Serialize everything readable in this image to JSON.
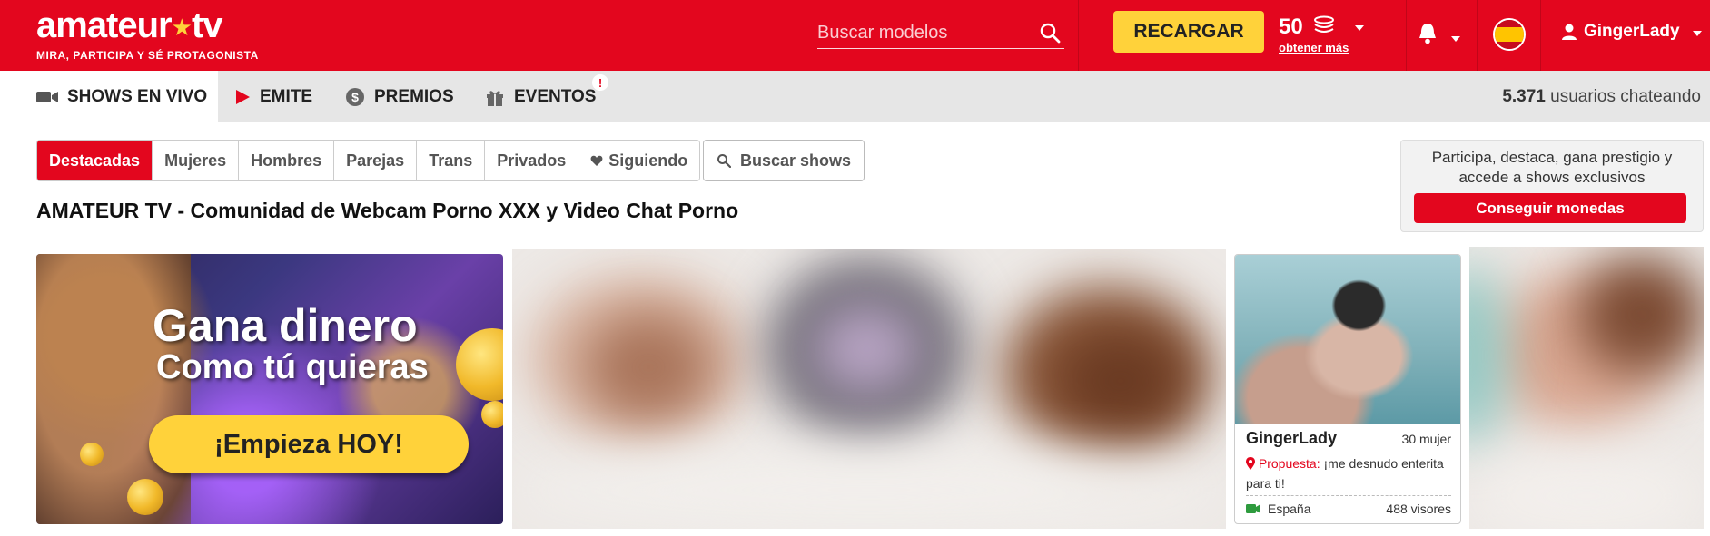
{
  "header": {
    "logo_main": "amateur",
    "logo_star": "★",
    "logo_suffix": "tv",
    "logo_tagline": "MIRA, PARTICIPA Y SÉ PROTAGONISTA",
    "search_placeholder": "Buscar modelos",
    "recharge_label": "RECARGAR",
    "coins_amount": "50",
    "coins_more": "obtener más",
    "username": "GingerLady",
    "accent_color": "#e3061e",
    "button_color": "#ffd23a"
  },
  "nav": {
    "items": [
      {
        "label": "SHOWS EN VIVO",
        "icon": "video-camera-icon"
      },
      {
        "label": "EMITE",
        "icon": "play-icon"
      },
      {
        "label": "PREMIOS",
        "icon": "dollar-coin-icon"
      },
      {
        "label": "EVENTOS",
        "icon": "gift-icon",
        "badge": "!"
      }
    ],
    "users_count": "5.371",
    "users_suffix": "usuarios chateando"
  },
  "filters": {
    "tabs": [
      "Destacadas",
      "Mujeres",
      "Hombres",
      "Parejas",
      "Trans",
      "Privados",
      "Siguiendo"
    ],
    "search_shows": "Buscar shows"
  },
  "page_title": "AMATEUR TV - Comunidad de Webcam Porno XXX y Video Chat Porno",
  "promo": {
    "text": "Participa, destaca, gana prestigio y accede a shows exclusivos",
    "button": "Conseguir monedas"
  },
  "banner": {
    "headline": "Gana dinero",
    "subheadline": "Como tú quieras",
    "cta": "¡Empieza HOY!"
  },
  "model_card": {
    "name": "GingerLady",
    "age_gender": "30 mujer",
    "proposal_label": "Propuesta:",
    "proposal_text": " ¡me desnudo enterita para ti!",
    "country": "España",
    "viewers": "488 visores"
  }
}
